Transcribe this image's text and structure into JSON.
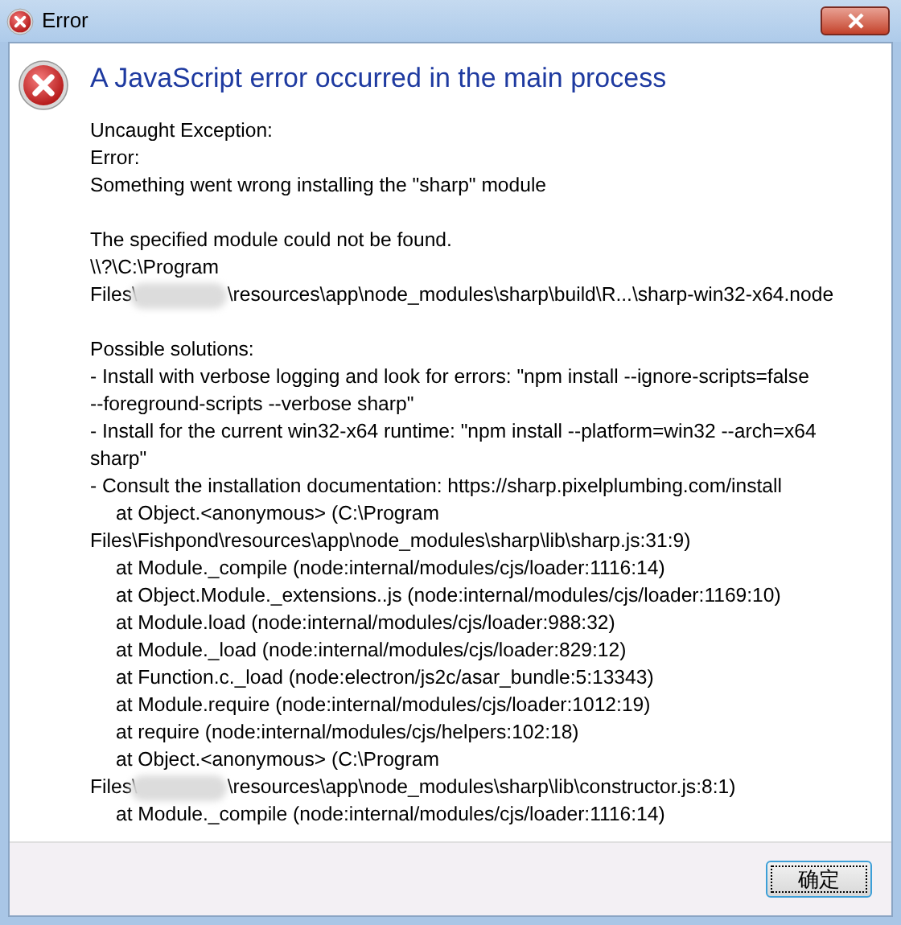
{
  "window": {
    "title": "Error"
  },
  "heading": "A JavaScript error occurred in the main process",
  "lines": [
    {
      "kind": "text",
      "text": "Uncaught Exception:"
    },
    {
      "kind": "text",
      "text": "Error:"
    },
    {
      "kind": "text",
      "text": "Something went wrong installing the \"sharp\" module"
    },
    {
      "kind": "blank"
    },
    {
      "kind": "text",
      "text": "The specified module could not be found."
    },
    {
      "kind": "text",
      "text": "\\\\?\\C:\\Program"
    },
    {
      "kind": "redacted",
      "before": "Files\\",
      "after": "\\resources\\app\\node_modules\\sharp\\build\\R...\\sharp-win32-x64.node"
    },
    {
      "kind": "blank"
    },
    {
      "kind": "text",
      "text": "Possible solutions:"
    },
    {
      "kind": "text",
      "text": "- Install with verbose logging and look for errors: \"npm install --ignore-scripts=false"
    },
    {
      "kind": "text",
      "text": "--foreground-scripts --verbose sharp\""
    },
    {
      "kind": "text",
      "text": "- Install for the current win32-x64 runtime: \"npm install --platform=win32 --arch=x64"
    },
    {
      "kind": "text",
      "text": "sharp\""
    },
    {
      "kind": "text",
      "text": "- Consult the installation documentation: https://sharp.pixelplumbing.com/install"
    },
    {
      "kind": "indent",
      "text": "at Object.<anonymous> (C:\\Program"
    },
    {
      "kind": "text",
      "text": "Files\\Fishpond\\resources\\app\\node_modules\\sharp\\lib\\sharp.js:31:9)"
    },
    {
      "kind": "indent",
      "text": "at Module._compile (node:internal/modules/cjs/loader:1116:14)"
    },
    {
      "kind": "indent",
      "text": "at Object.Module._extensions..js (node:internal/modules/cjs/loader:1169:10)"
    },
    {
      "kind": "indent",
      "text": "at Module.load (node:internal/modules/cjs/loader:988:32)"
    },
    {
      "kind": "indent",
      "text": "at Module._load (node:internal/modules/cjs/loader:829:12)"
    },
    {
      "kind": "indent",
      "text": "at Function.c._load (node:electron/js2c/asar_bundle:5:13343)"
    },
    {
      "kind": "indent",
      "text": "at Module.require (node:internal/modules/cjs/loader:1012:19)"
    },
    {
      "kind": "indent",
      "text": "at require (node:internal/modules/cjs/helpers:102:18)"
    },
    {
      "kind": "indent",
      "text": "at Object.<anonymous> (C:\\Program"
    },
    {
      "kind": "redacted",
      "before": "Files\\",
      "after": "\\resources\\app\\node_modules\\sharp\\lib\\constructor.js:8:1)"
    },
    {
      "kind": "indent",
      "text": "at Module._compile (node:internal/modules/cjs/loader:1116:14)"
    }
  ],
  "buttons": [
    {
      "label": "确定"
    }
  ]
}
